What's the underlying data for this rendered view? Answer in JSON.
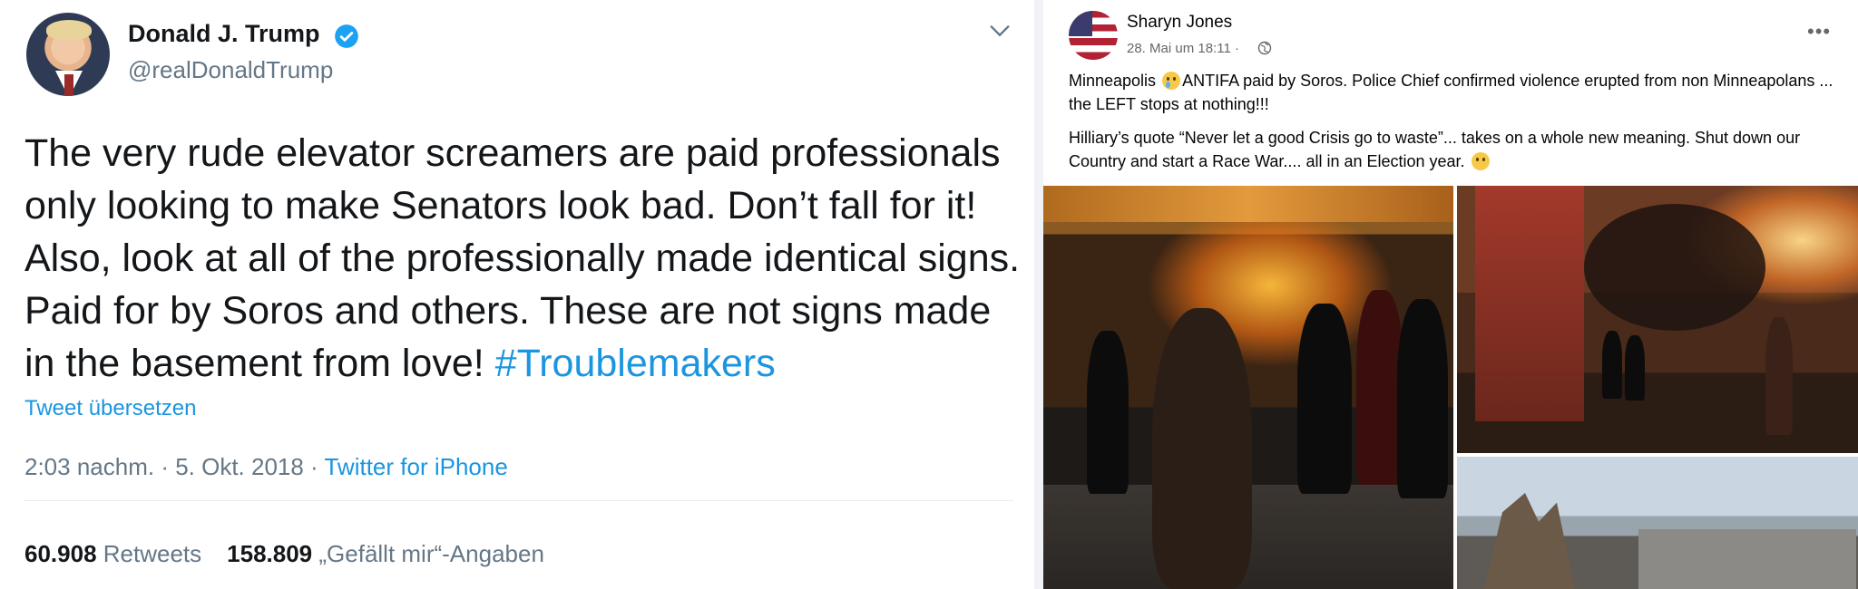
{
  "tweet": {
    "name": "Donald J. Trump",
    "handle": "@realDonaldTrump",
    "text": "The very rude elevator screamers are paid professionals only looking to make Senators look bad. Don’t fall for it! Also, look at all of the professionally made identical signs. Paid for by Soros and others. These are not signs made in the basement from love! ",
    "hashtag": "#Troublemakers",
    "translate_label": "Tweet übersetzen",
    "time": "2:03 nachm. · 5. Okt. 2018 · ",
    "source": "Twitter for iPhone",
    "retweets_count": "60.908",
    "retweets_label": "Retweets",
    "likes_count": "158.809",
    "likes_label": "„Gefällt mir“-Angaben",
    "icons": {
      "verified": "verified-badge-icon",
      "more": "chevron-down-icon"
    },
    "colors": {
      "link": "#1b95e0",
      "text": "#14171a",
      "muted": "#657786"
    }
  },
  "facebook_post": {
    "author": "Sharyn Jones",
    "time": "28. Mai um 18:11 · ",
    "more": "•••",
    "text1_a": "Minneapolis ",
    "text1_b": "ANTIFA paid by Soros. Police Chief confirmed violence erupted from non Minneapolans ... the LEFT stops at nothing!!!",
    "text2_a": "Hilliary’s quote “Never let a good Crisis go to waste”... takes on a whole new meaning. Shut down our Country and start a Race War.... all in an Election year. ",
    "icons": {
      "audience": "globe-icon",
      "emoji1": "crying-face-icon",
      "emoji2": "thinking-face-icon"
    },
    "photos": [
      "riot-fire-photo",
      "target-store-fire-photo",
      "burned-building-photo"
    ]
  }
}
